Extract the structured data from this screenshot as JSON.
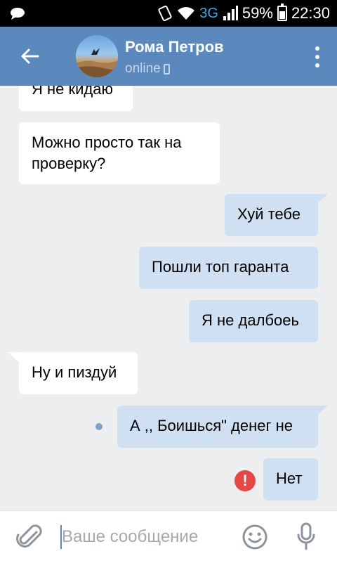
{
  "status_bar": {
    "network": "3G",
    "battery": "59%",
    "time": "22:30",
    "icons": [
      "chat-bubble-icon",
      "vibrate-icon",
      "wifi-icon",
      "signal-icon",
      "battery-icon"
    ]
  },
  "header": {
    "contact_name": "Рома Петров",
    "contact_status": "online",
    "back_icon": "arrow-left-icon",
    "menu_icon": "more-vertical-icon"
  },
  "messages": [
    {
      "direction": "in",
      "text": "Я не кидаю"
    },
    {
      "direction": "in",
      "text": "Можно просто так на проверку?"
    },
    {
      "direction": "out",
      "text": "Хуй тебе"
    },
    {
      "direction": "out",
      "text": "Пошли топ гаранта"
    },
    {
      "direction": "out",
      "text": "Я не далбоеь"
    },
    {
      "direction": "in",
      "text": "Ну и пиздуй"
    },
    {
      "direction": "out",
      "text": "А ,, Боишься\" денег не",
      "state": "unread"
    },
    {
      "direction": "out",
      "text": "Нет",
      "state": "error"
    }
  ],
  "error_mark": "!",
  "input_bar": {
    "placeholder": "Ваше сообщение",
    "value": ""
  },
  "colors": {
    "header": "#5b88bd",
    "background": "#edeef0",
    "incoming_bubble": "#ffffff",
    "outgoing_bubble": "#cfe0f2",
    "error": "#e64646"
  }
}
